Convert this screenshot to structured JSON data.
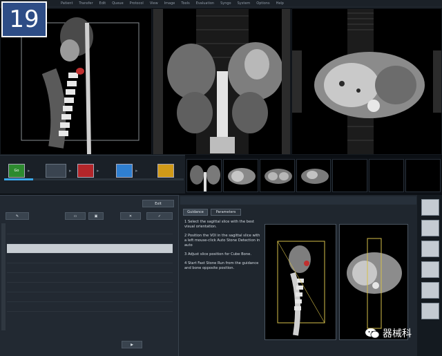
{
  "badge": {
    "number": "19"
  },
  "menubar": [
    "Patient",
    "Transfer",
    "Edit",
    "Queue",
    "Protocol",
    "View",
    "Image",
    "Tools",
    "Evaluation",
    "Syngo",
    "System",
    "Options",
    "Help"
  ],
  "protocol_row": {
    "buttons": [
      {
        "label": "Go",
        "color": "#2d8a2f"
      },
      {
        "label": "",
        "color": "#b3262a"
      },
      {
        "label": "",
        "color": "#2f7fd0"
      },
      {
        "label": "",
        "color": "#d19a18"
      }
    ]
  },
  "list_panel": {
    "top_button": "Exit",
    "rows": [
      {
        "num": "",
        "name": "",
        "time": "",
        "selected": false
      },
      {
        "num": "",
        "name": "",
        "time": "",
        "selected": false
      },
      {
        "num": "",
        "name": "",
        "time": "",
        "selected": true
      },
      {
        "num": "",
        "name": "",
        "time": "",
        "selected": false
      },
      {
        "num": "",
        "name": "",
        "time": "",
        "selected": false
      },
      {
        "num": "",
        "name": "",
        "time": "",
        "selected": false
      },
      {
        "num": "",
        "name": "",
        "time": "",
        "selected": false
      },
      {
        "num": "",
        "name": "",
        "time": "",
        "selected": false
      },
      {
        "num": "",
        "name": "",
        "time": "",
        "selected": false
      }
    ]
  },
  "info_panel": {
    "tabs": [
      "Guidance",
      "Parameters"
    ],
    "steps": [
      "1  Select the sagittal slice with the best visual orientation.",
      "2  Position the VOI in the sagittal slice with a left mouse-click Auto Stone Detection in auto",
      "3  Adjust slice position for Cube Bone.",
      "4  Start Fast Stone Run from the guidance and bone opposite position."
    ]
  },
  "watermark": {
    "text": "器械科"
  },
  "colors": {
    "selection": "#c7cdd3",
    "accent": "#3aa7e8"
  }
}
